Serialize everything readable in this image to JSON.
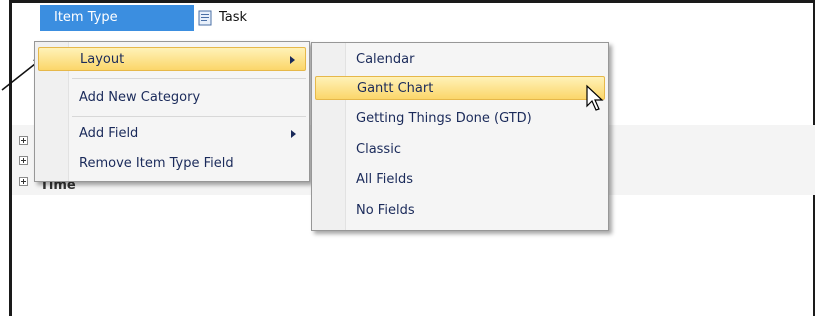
{
  "grid": {
    "item_type_label": "Item Type",
    "task_value": "Task",
    "row_label": "Time"
  },
  "context_menu": {
    "items": [
      {
        "label": "Layout",
        "has_submenu": true,
        "highlighted": true
      },
      {
        "label": "Add New Category",
        "has_submenu": false
      },
      {
        "label": "Add Field",
        "has_submenu": true
      },
      {
        "label": "Remove Item Type Field",
        "has_submenu": false
      }
    ]
  },
  "layout_submenu": {
    "items": [
      {
        "label": "Calendar"
      },
      {
        "label": "Gantt Chart",
        "highlighted": true
      },
      {
        "label": "Getting Things Done (GTD)"
      },
      {
        "label": "Classic"
      },
      {
        "label": "All Fields"
      },
      {
        "label": "No Fields"
      }
    ]
  },
  "icons": {
    "task": "task-document-icon",
    "expand": "plus-box-icon",
    "submenu": "submenu-arrow-icon",
    "cursor": "mouse-pointer-icon"
  },
  "colors": {
    "selection_blue": "#3b8ee0",
    "menu_highlight": "#fbd66a",
    "menu_text": "#1a2a5a"
  }
}
